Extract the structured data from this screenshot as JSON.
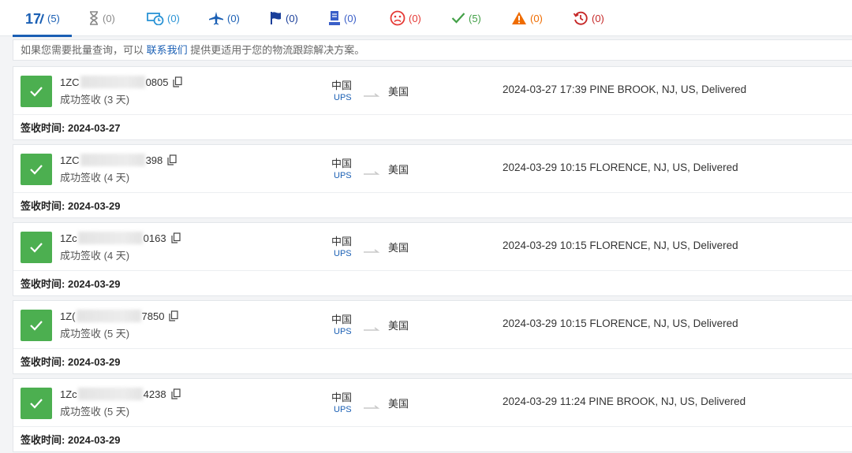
{
  "tabs": [
    {
      "name": "tab-all",
      "icon": "logo-17-icon",
      "count": "(5)",
      "color": "#1a5fb4",
      "active": true
    },
    {
      "name": "tab-not-found",
      "icon": "hourglass-icon",
      "count": "(0)",
      "color": "#888888"
    },
    {
      "name": "tab-info-received",
      "icon": "truck-clock-icon",
      "count": "(0)",
      "color": "#2a93d5"
    },
    {
      "name": "tab-in-transit",
      "icon": "airplane-icon",
      "count": "(0)",
      "color": "#1a5fb4"
    },
    {
      "name": "tab-pick-up",
      "icon": "flag-icon",
      "count": "(0)",
      "color": "#1a3f9a"
    },
    {
      "name": "tab-out-for-delivery",
      "icon": "courier-icon",
      "count": "(0)",
      "color": "#3a5fc8"
    },
    {
      "name": "tab-undelivered",
      "icon": "sad-face-icon",
      "count": "(0)",
      "color": "#e53935"
    },
    {
      "name": "tab-delivered",
      "icon": "checkmark-icon",
      "count": "(5)",
      "color": "#43a047"
    },
    {
      "name": "tab-alert",
      "icon": "warning-icon",
      "count": "(0)",
      "color": "#ef6c00"
    },
    {
      "name": "tab-expired",
      "icon": "history-icon",
      "count": "(0)",
      "color": "#c62828"
    }
  ],
  "notice": {
    "before": "如果您需要批量查询，可以",
    "link": "联系我们",
    "after": "提供更适用于您的物流跟踪解决方案。"
  },
  "shipments": [
    {
      "prefix": "1ZC",
      "suffix": "0805",
      "status": "成功签收 (3 天)",
      "origin": "中国",
      "carrier": "UPS",
      "destination": "美国",
      "event": "2024-03-27 17:39 PINE BROOK, NJ, US, Delivered",
      "signed_label": "签收时间:",
      "signed_date": "2024-03-27"
    },
    {
      "prefix": "1ZC",
      "suffix": "398",
      "status": "成功签收 (4 天)",
      "origin": "中国",
      "carrier": "UPS",
      "destination": "美国",
      "event": "2024-03-29 10:15 FLORENCE, NJ, US, Delivered",
      "signed_label": "签收时间:",
      "signed_date": "2024-03-29"
    },
    {
      "prefix": "1Zc",
      "suffix": "0163",
      "status": "成功签收 (4 天)",
      "origin": "中国",
      "carrier": "UPS",
      "destination": "美国",
      "event": "2024-03-29 10:15 FLORENCE, NJ, US, Delivered",
      "signed_label": "签收时间:",
      "signed_date": "2024-03-29"
    },
    {
      "prefix": "1Z(",
      "suffix": "7850",
      "status": "成功签收 (5 天)",
      "origin": "中国",
      "carrier": "UPS",
      "destination": "美国",
      "event": "2024-03-29 10:15 FLORENCE, NJ, US, Delivered",
      "signed_label": "签收时间:",
      "signed_date": "2024-03-29"
    },
    {
      "prefix": "1Zc",
      "suffix": "4238",
      "status": "成功签收 (5 天)",
      "origin": "中国",
      "carrier": "UPS",
      "destination": "美国",
      "event": "2024-03-29 11:24 PINE BROOK, NJ, US, Delivered",
      "signed_label": "签收时间:",
      "signed_date": "2024-03-29"
    }
  ]
}
